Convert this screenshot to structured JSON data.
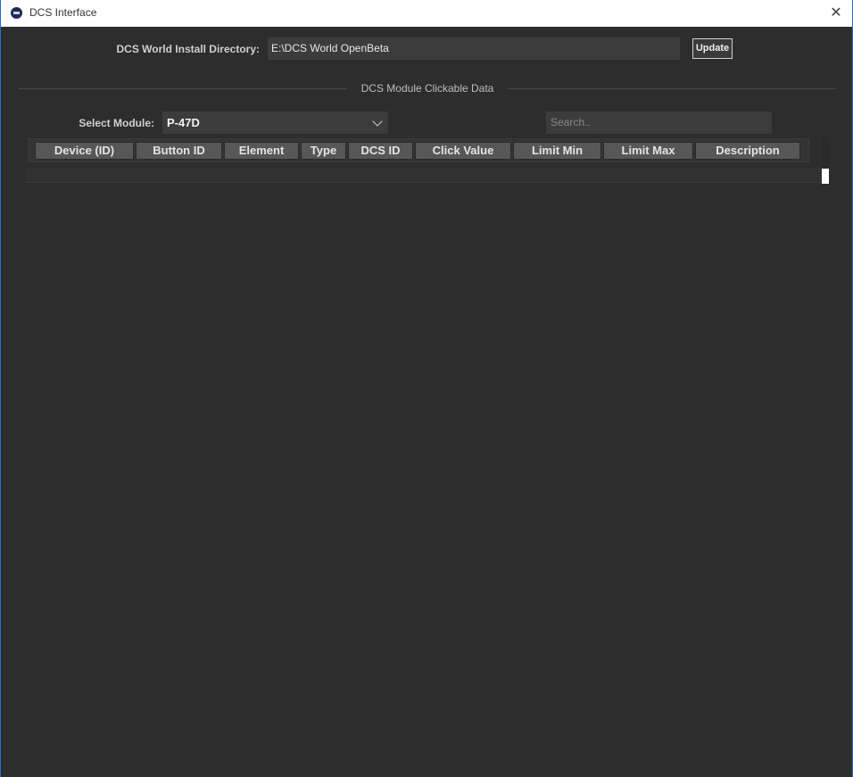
{
  "window": {
    "title": "DCS Interface",
    "close_icon": "close-icon"
  },
  "install": {
    "label": "DCS World Install Directory:",
    "value": "E:\\DCS World OpenBeta",
    "update_label": "Update"
  },
  "section": {
    "title": "DCS Module Clickable Data"
  },
  "module": {
    "label": "Select Module:",
    "selected": "P-47D"
  },
  "search": {
    "placeholder": "Search.."
  },
  "table": {
    "columns": [
      "Device (ID)",
      "Button ID",
      "Element",
      "Type",
      "DCS ID",
      "Click Value",
      "Limit Min",
      "Limit Max",
      "Description"
    ]
  }
}
